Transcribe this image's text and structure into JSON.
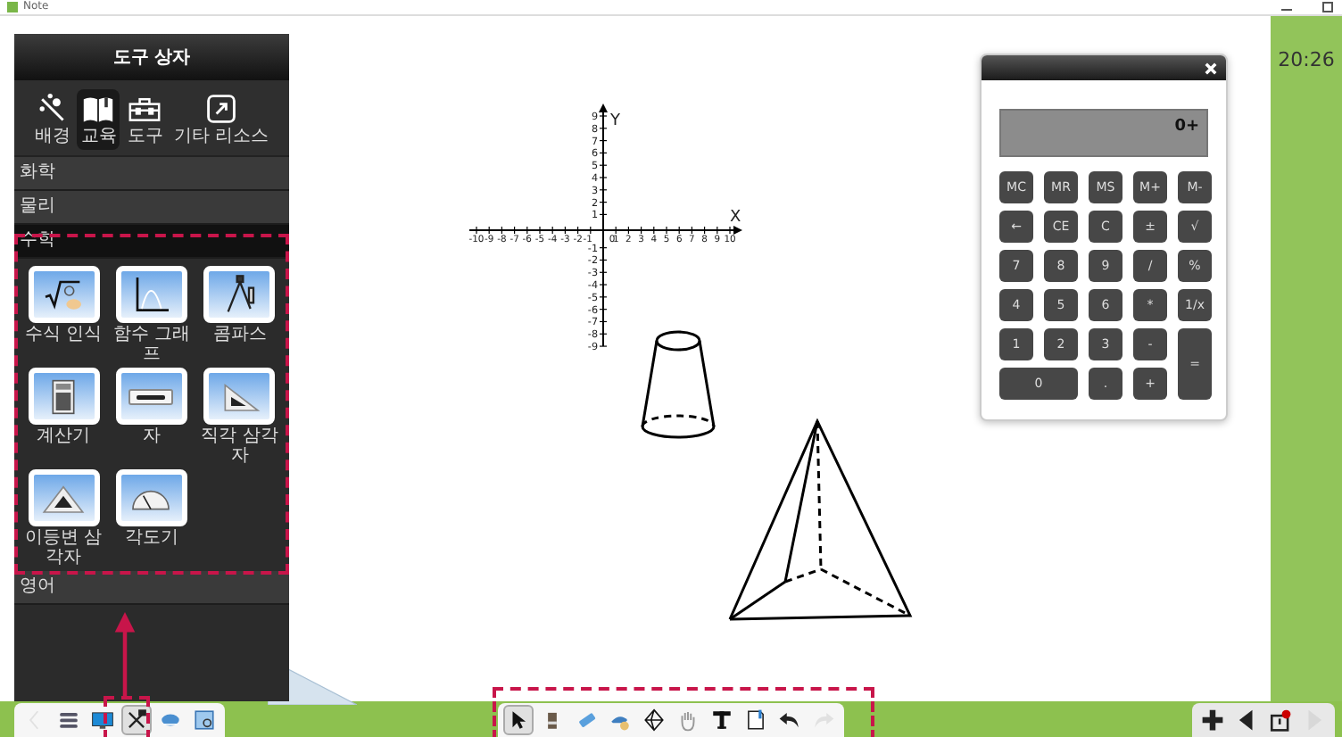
{
  "window": {
    "title": "Note"
  },
  "toolbox": {
    "title": "도구 상자",
    "categories": [
      {
        "label": "배경",
        "kind": "wand",
        "selected": false
      },
      {
        "label": "교육",
        "kind": "book",
        "selected": true
      },
      {
        "label": "도구",
        "kind": "toolbox",
        "selected": false
      },
      {
        "label": "기타 리소스",
        "kind": "link",
        "selected": false
      }
    ],
    "sections": [
      {
        "label": "화학",
        "expanded": false
      },
      {
        "label": "물리",
        "expanded": false
      },
      {
        "label": "수학",
        "expanded": true,
        "items": [
          {
            "label": "수식 인식",
            "kind": "formula"
          },
          {
            "label": "함수 그래프",
            "kind": "graph"
          },
          {
            "label": "콤파스",
            "kind": "compass"
          },
          {
            "label": "계산기",
            "kind": "calculator"
          },
          {
            "label": "자",
            "kind": "ruler"
          },
          {
            "label": "직각 삼각자",
            "kind": "right-triangle"
          },
          {
            "label": "이등변 삼각자",
            "kind": "isosceles"
          },
          {
            "label": "각도기",
            "kind": "protractor"
          }
        ]
      },
      {
        "label": "영어",
        "expanded": false
      }
    ]
  },
  "coordinate_plane": {
    "x_label": "X",
    "y_label": "Y",
    "x_ticks": [
      "-10",
      "-9",
      "-8",
      "-7",
      "-6",
      "-5",
      "-4",
      "-3",
      "-2",
      "-1",
      "0",
      "1",
      "2",
      "3",
      "4",
      "5",
      "6",
      "7",
      "8",
      "9",
      "10"
    ],
    "y_ticks": [
      "9",
      "8",
      "7",
      "6",
      "5",
      "4",
      "3",
      "2",
      "1",
      "-1",
      "-2",
      "-3",
      "-4",
      "-5",
      "-6",
      "-7",
      "-8",
      "-9"
    ]
  },
  "calculator": {
    "display": "0+",
    "keys": [
      {
        "label": "MC",
        "kind": "normal"
      },
      {
        "label": "MR",
        "kind": "normal"
      },
      {
        "label": "MS",
        "kind": "normal"
      },
      {
        "label": "M+",
        "kind": "normal"
      },
      {
        "label": "M-",
        "kind": "normal"
      },
      {
        "label": "←",
        "kind": "normal"
      },
      {
        "label": "CE",
        "kind": "normal"
      },
      {
        "label": "C",
        "kind": "normal"
      },
      {
        "label": "±",
        "kind": "normal"
      },
      {
        "label": "√",
        "kind": "normal"
      },
      {
        "label": "7",
        "kind": "normal"
      },
      {
        "label": "8",
        "kind": "normal"
      },
      {
        "label": "9",
        "kind": "normal"
      },
      {
        "label": "/",
        "kind": "normal"
      },
      {
        "label": "%",
        "kind": "normal"
      },
      {
        "label": "4",
        "kind": "normal"
      },
      {
        "label": "5",
        "kind": "normal"
      },
      {
        "label": "6",
        "kind": "normal"
      },
      {
        "label": "*",
        "kind": "normal"
      },
      {
        "label": "1/x",
        "kind": "normal"
      },
      {
        "label": "1",
        "kind": "normal"
      },
      {
        "label": "2",
        "kind": "normal"
      },
      {
        "label": "3",
        "kind": "normal"
      },
      {
        "label": "-",
        "kind": "normal"
      },
      {
        "label": "=",
        "kind": "tall"
      },
      {
        "label": "0",
        "kind": "wide"
      },
      {
        "label": ".",
        "kind": "normal"
      },
      {
        "label": "+",
        "kind": "normal"
      }
    ]
  },
  "clock": "20:26",
  "left_toolbar": [
    {
      "kind": "back",
      "selected": false,
      "disabled": true
    },
    {
      "kind": "menu",
      "selected": false,
      "disabled": false
    },
    {
      "kind": "monitor",
      "selected": false,
      "disabled": false
    },
    {
      "kind": "toolbox",
      "selected": true,
      "disabled": false
    },
    {
      "kind": "cloud",
      "selected": false,
      "disabled": false
    },
    {
      "kind": "image",
      "selected": false,
      "disabled": false
    }
  ],
  "center_toolbar": [
    {
      "kind": "pointer",
      "selected": true,
      "disabled": false
    },
    {
      "kind": "pen",
      "selected": false,
      "disabled": false
    },
    {
      "kind": "eraser",
      "selected": false,
      "disabled": false
    },
    {
      "kind": "highlighter",
      "selected": false,
      "disabled": false
    },
    {
      "kind": "shape",
      "selected": false,
      "disabled": false
    },
    {
      "kind": "hand",
      "selected": false,
      "disabled": false
    },
    {
      "kind": "text",
      "selected": false,
      "disabled": false
    },
    {
      "kind": "page",
      "selected": false,
      "disabled": false
    },
    {
      "kind": "undo",
      "selected": false,
      "disabled": false
    },
    {
      "kind": "redo",
      "selected": false,
      "disabled": true
    }
  ],
  "right_toolbar": [
    {
      "kind": "add",
      "selected": false,
      "disabled": false
    },
    {
      "kind": "prev",
      "selected": false,
      "disabled": false
    },
    {
      "kind": "export",
      "selected": false,
      "disabled": false
    },
    {
      "kind": "next",
      "selected": false,
      "disabled": true
    }
  ]
}
